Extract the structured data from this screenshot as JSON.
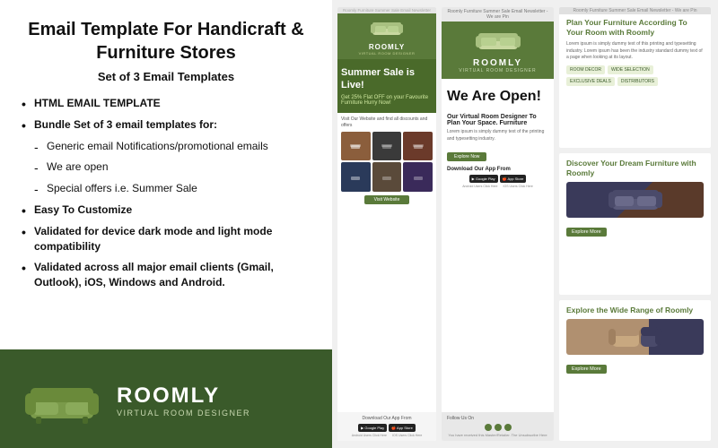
{
  "left": {
    "title": "Email Template For Handicraft & Furniture Stores",
    "subtitle": "Set of 3 Email Templates",
    "features": [
      {
        "text": "HTML EMAIL TEMPLATE",
        "type": "bullet"
      },
      {
        "text": "Bundle Set of 3 email templates for:",
        "type": "bullet"
      },
      {
        "text": "Generic email Notifications/promotional emails",
        "type": "sub"
      },
      {
        "text": "We are open",
        "type": "sub"
      },
      {
        "text": "Special offers i.e. Summer Sale",
        "type": "sub"
      },
      {
        "text": "Easy To Customize",
        "type": "bullet"
      },
      {
        "text": "Validated for device dark mode and light mode compatibility",
        "type": "bullet"
      },
      {
        "text": "Validated across all major email clients (Gmail, Outlook), iOS, Windows and Android.",
        "type": "bullet"
      }
    ],
    "brand": {
      "name": "ROOMLY",
      "tagline": "VIRTUAL ROOM DESIGNER"
    }
  },
  "previews": {
    "email1": {
      "logo": "ROOMLY",
      "logo_sub": "VIRTUAL ROOM DESIGNER",
      "hero_text": "Summer Sale is Live!",
      "hero_sub": "Get 25% Flat OFF on your Favourite Furniture Hurry Now!",
      "body_text": "Visit Our Website and find all discounts and offers",
      "btn": "Visit Website",
      "footer_title": "Download Our App From",
      "google_play": "Google Play",
      "app_store": "App Store",
      "android_label": "Android Users Click Here",
      "ios_label": "IOS Users Click Here"
    },
    "email2": {
      "top_text": "Roomly Furniture Summer Sale Email Newsletter - We are Pin",
      "logo": "ROOMLY",
      "logo_sub": "VIRTUAL ROOM DESIGNER",
      "hero_text": "We Are Open!",
      "body_title": "Our Virtual Room Designer To Plan Your Space. Furniture",
      "body_text": "Lorem ipsum is simply dummy text of the printing and typesetting industry.",
      "explore_btn": "Explore Now",
      "app_title": "Download Our App From",
      "footer_title": "Follow Us On"
    },
    "cards": {
      "top_text": "Roomly Furniture Summer Sale Email Newsletter - We are Pin",
      "card1": {
        "title": "Plan Your Furniture According To Your Room with",
        "title_accent": "Roomly",
        "body": "Lorem ipsum is simply dummy text of this printing and typesetting industry. Lorem ipsum has been the industry standard dummy text of a page when looking at its layout.",
        "tags": [
          "ROOM DECOR",
          "WIDE SELECTION",
          "EXCLUSIVE DEALS",
          "DISTRIBUTORS"
        ]
      },
      "card2": {
        "title": "Discover Your Dream Furniture with",
        "title_accent": "Roomly"
      },
      "card3": {
        "title": "Explore the Wide Range of",
        "title_accent": "Roomly"
      }
    }
  },
  "colors": {
    "brand_green": "#3a5a2a",
    "mid_green": "#5a7a3a",
    "light_green": "#e8f0d8",
    "sofa_brown": "#8B5E3C"
  }
}
